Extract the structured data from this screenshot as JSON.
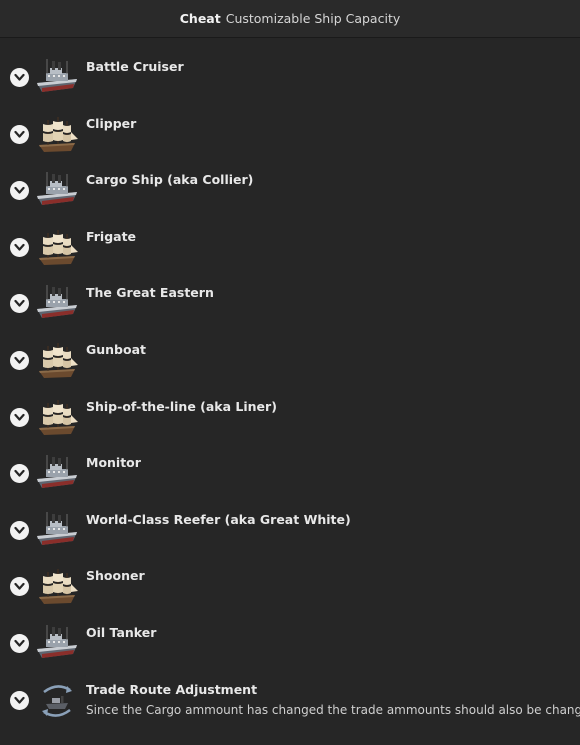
{
  "header": {
    "prefix": "Cheat",
    "title": "Customizable Ship Capacity"
  },
  "items": [
    {
      "label": "Battle Cruiser",
      "icon": "battle-cruiser-icon",
      "kind": "steam"
    },
    {
      "label": "Clipper",
      "icon": "clipper-icon",
      "kind": "sail"
    },
    {
      "label": "Cargo Ship (aka Collier)",
      "icon": "cargo-ship-icon",
      "kind": "steam"
    },
    {
      "label": "Frigate",
      "icon": "frigate-icon",
      "kind": "sail"
    },
    {
      "label": "The Great Eastern",
      "icon": "great-eastern-icon",
      "kind": "steam"
    },
    {
      "label": "Gunboat",
      "icon": "gunboat-icon",
      "kind": "sail"
    },
    {
      "label": "Ship-of-the-line (aka Liner)",
      "icon": "ship-of-the-line-icon",
      "kind": "sail"
    },
    {
      "label": "Monitor",
      "icon": "monitor-icon",
      "kind": "steam"
    },
    {
      "label": "World-Class Reefer (aka Great White)",
      "icon": "reefer-icon",
      "kind": "steam"
    },
    {
      "label": "Shooner",
      "icon": "schooner-icon",
      "kind": "sail"
    },
    {
      "label": "Oil Tanker",
      "icon": "oil-tanker-icon",
      "kind": "steam"
    },
    {
      "label": "Trade Route Adjustment",
      "icon": "trade-route-icon",
      "kind": "route",
      "description": "Since the Cargo ammount has changed the trade ammounts should also be changed."
    }
  ],
  "colors": {
    "background": "#262626",
    "header_background": "#2a2a2a",
    "chevron_background": "#f2f2f2",
    "text": "#e8e8e8"
  }
}
